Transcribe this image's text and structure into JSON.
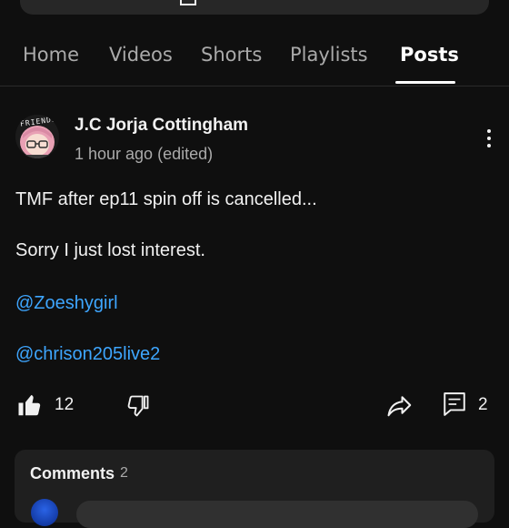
{
  "tabs": [
    {
      "label": "Home"
    },
    {
      "label": "Videos"
    },
    {
      "label": "Shorts"
    },
    {
      "label": "Playlists"
    },
    {
      "label": "Posts",
      "active": true
    }
  ],
  "post": {
    "author": "J.C Jorja Cottingham",
    "time": "1 hour ago (edited)",
    "avatar_text": "FRIENDS",
    "lines": [
      "TMF after ep11 spin off is cancelled...",
      "Sorry I just lost interest."
    ],
    "mentions": [
      "@Zoeshygirl",
      "@chrison205live2"
    ],
    "like_count": "12",
    "comment_count": "2"
  },
  "comments": {
    "title": "Comments",
    "count": "2"
  },
  "colors": {
    "background": "#0f0f0f",
    "text": "#f1f1f1",
    "secondary_text": "#aaaaaa",
    "link": "#3ea6ff",
    "card": "#1f1f1f"
  },
  "icons": [
    "like-icon",
    "dislike-icon",
    "share-icon",
    "comment-icon",
    "more-vert-icon"
  ]
}
